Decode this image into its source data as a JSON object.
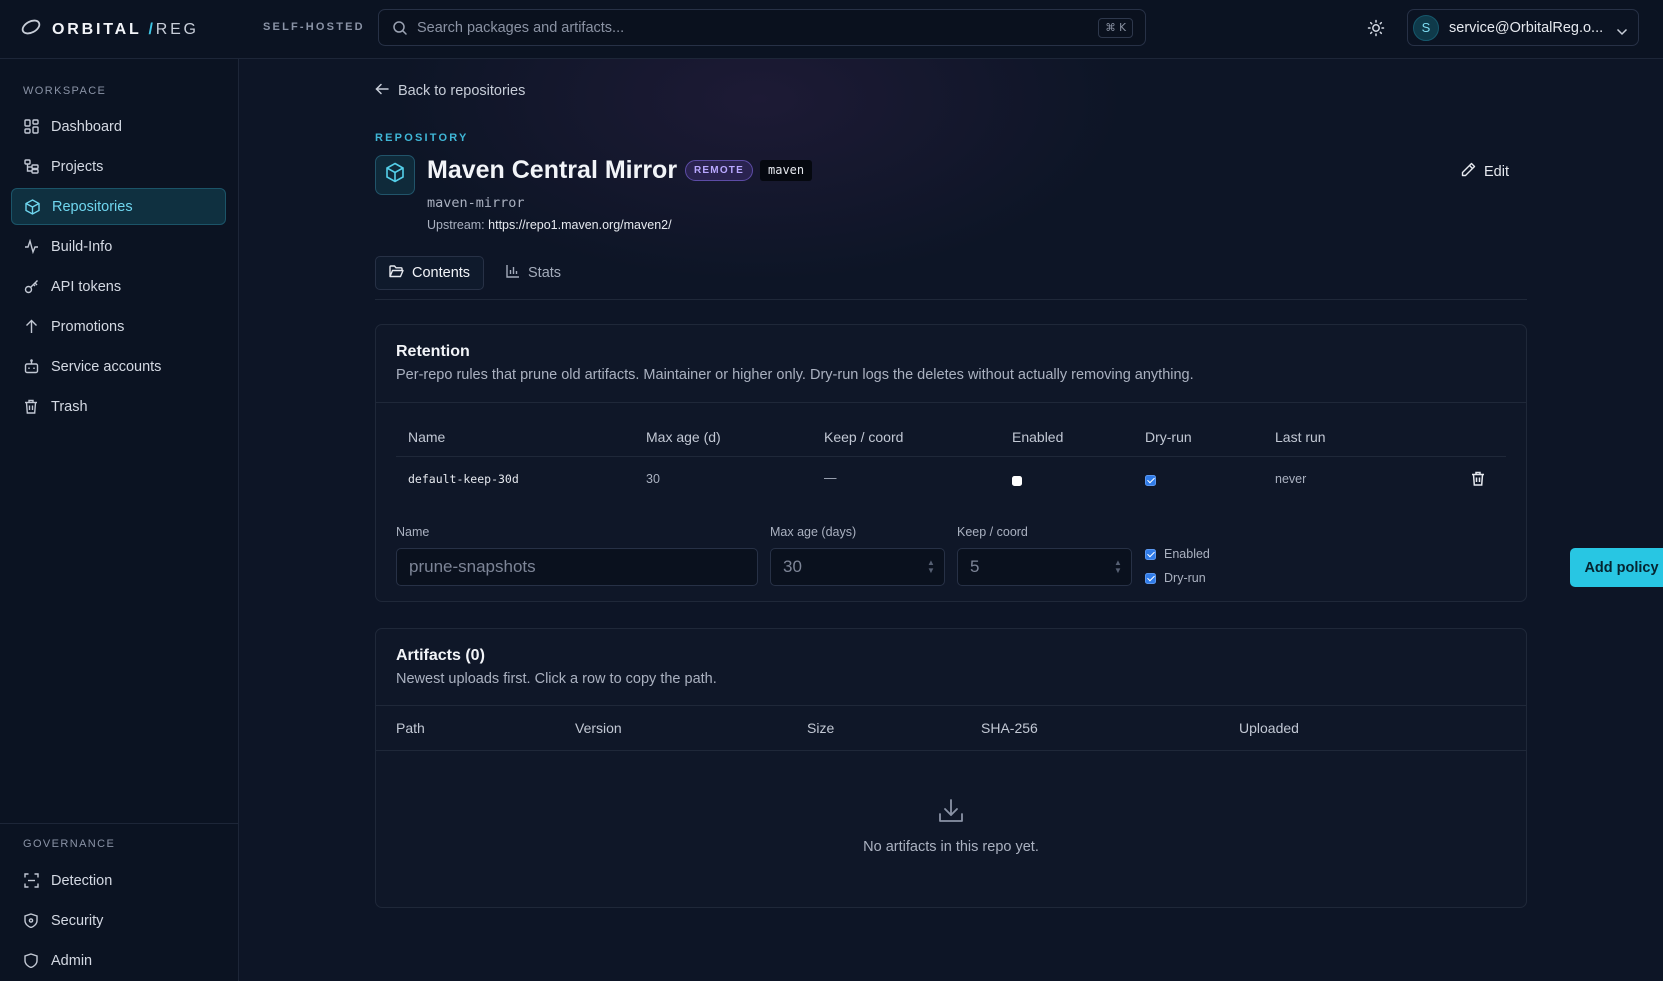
{
  "brand": {
    "name": "ORBITAL",
    "slash": "/",
    "suffix": "REG"
  },
  "deployment_badge": "SELF-HOSTED",
  "search": {
    "placeholder": "Search packages and artifacts...",
    "shortcut": "⌘ K"
  },
  "account": {
    "initial": "S",
    "email": "service@OrbitalReg.o..."
  },
  "sidebar": {
    "workspace_label": "WORKSPACE",
    "items": [
      {
        "label": "Dashboard",
        "icon": "grid-icon"
      },
      {
        "label": "Projects",
        "icon": "folder-tree-icon"
      },
      {
        "label": "Repositories",
        "icon": "package-icon",
        "active": true
      },
      {
        "label": "Build-Info",
        "icon": "activity-icon"
      },
      {
        "label": "API tokens",
        "icon": "key-icon"
      },
      {
        "label": "Promotions",
        "icon": "arrow-up-icon"
      },
      {
        "label": "Service accounts",
        "icon": "bot-icon"
      },
      {
        "label": "Trash",
        "icon": "trash-icon"
      }
    ],
    "governance_label": "GOVERNANCE",
    "governance_items": [
      {
        "label": "Detection",
        "icon": "scan-icon"
      },
      {
        "label": "Security",
        "icon": "shield-icon"
      },
      {
        "label": "Admin",
        "icon": "shield-admin-icon"
      }
    ]
  },
  "page": {
    "back_label": "Back to repositories",
    "eyebrow": "REPOSITORY",
    "title": "Maven Central Mirror",
    "type_badge": "REMOTE",
    "format_badge": "maven",
    "key": "maven-mirror",
    "upstream_label": "Upstream:",
    "upstream_url": "https://repo1.maven.org/maven2/",
    "edit_label": "Edit",
    "tabs": [
      {
        "label": "Contents",
        "active": true
      },
      {
        "label": "Stats",
        "active": false
      }
    ]
  },
  "retention": {
    "title": "Retention",
    "subtitle": "Per-repo rules that prune old artifacts. Maintainer or higher only. Dry-run logs the deletes without actually removing anything.",
    "columns": [
      "Name",
      "Max age (d)",
      "Keep / coord",
      "Enabled",
      "Dry-run",
      "Last run"
    ],
    "rows": [
      {
        "name": "default-keep-30d",
        "max_age": "30",
        "keep": "—",
        "enabled": false,
        "dry_run": true,
        "last_run": "never"
      }
    ],
    "form": {
      "name_label": "Name",
      "name_placeholder": "prune-snapshots",
      "max_age_label": "Max age (days)",
      "max_age_placeholder": "30",
      "keep_label": "Keep / coord",
      "keep_placeholder": "5",
      "enabled_label": "Enabled",
      "enabled_checked": true,
      "dry_run_label": "Dry-run",
      "dry_run_checked": true,
      "submit_label": "Add policy"
    }
  },
  "artifacts": {
    "title": "Artifacts (0)",
    "subtitle": "Newest uploads first. Click a row to copy the path.",
    "columns": [
      "Path",
      "Version",
      "Size",
      "SHA-256",
      "Uploaded"
    ],
    "empty_text": "No artifacts in this repo yet."
  },
  "colors": {
    "accent": "#28c6e3",
    "remote_badge": "#b9a8ff",
    "checkbox": "#2f7be8"
  }
}
